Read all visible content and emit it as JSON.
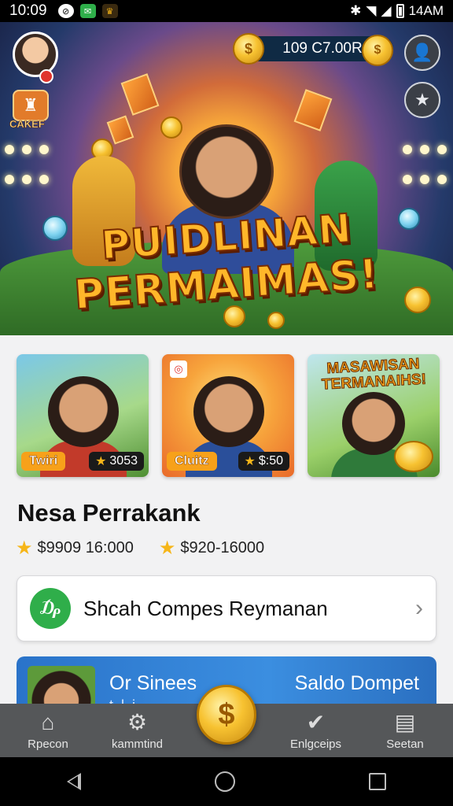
{
  "status_bar": {
    "time": "10:09",
    "clock_right": "14AM",
    "icons": [
      "no-disturb-icon",
      "chat-app-icon",
      "game-app-icon",
      "bluetooth-icon",
      "wifi-icon",
      "signal-icon",
      "battery-icon"
    ]
  },
  "hero": {
    "title_line1": "PUIDLINAN",
    "title_line2": "PERMAIMAS!",
    "balance": "109 C7.00R",
    "chef_label": "CAKEF",
    "icons": [
      "profile-avatar",
      "account-icon",
      "badge-star-icon"
    ]
  },
  "game_cards": [
    {
      "tag": "Twiri",
      "price": "3053"
    },
    {
      "tag": "Cluitz",
      "price": "$:50"
    },
    {
      "title": "MASAWISAN TERMANAIHS!"
    }
  ],
  "section": {
    "title": "Nesa Perrakank",
    "ratings": [
      "$9909 16:000",
      "$920-16000"
    ]
  },
  "search_card": {
    "label": "Shcah Compes Reymanan"
  },
  "promo": {
    "left_text": "Or Sinees",
    "right_text": "Saldo Dompet",
    "sub_text": "t..l..i.."
  },
  "bottom_nav": [
    {
      "label": "Rpecon",
      "icon": "home-icon"
    },
    {
      "label": "kammtind",
      "icon": "gear-icon"
    },
    {
      "label": "Enlgceips",
      "icon": "check-circle-icon"
    },
    {
      "label": "Seetan",
      "icon": "wallet-icon"
    }
  ],
  "colors": {
    "accent_orange": "#f7a11a",
    "title_gold": "#ffb72a",
    "promo_blue": "#2a73c9",
    "nav_gray": "#555759",
    "search_green": "#2fae4a"
  }
}
